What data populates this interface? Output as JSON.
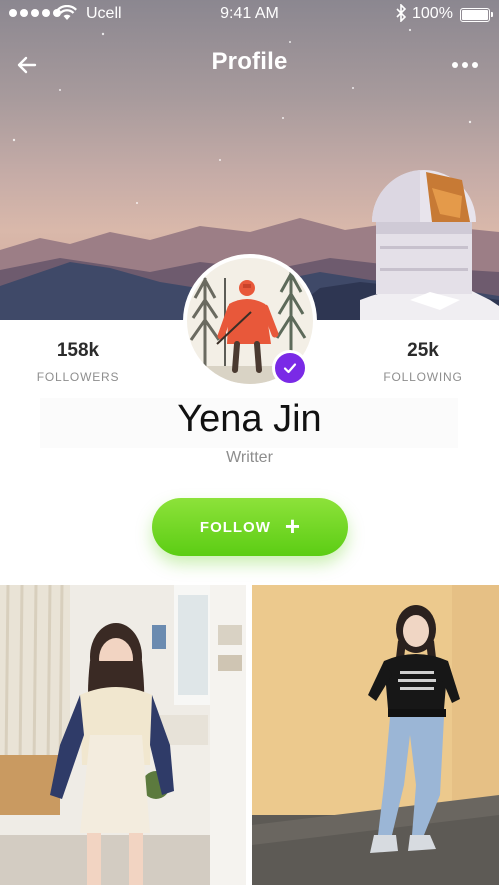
{
  "status_bar": {
    "carrier": "Ucell",
    "time": "9:41 AM",
    "battery": "100%",
    "signal_icon": "signal-dots-icon",
    "wifi_icon": "wifi-icon",
    "bluetooth_icon": "bluetooth-icon",
    "battery_icon": "battery-icon"
  },
  "nav": {
    "title": "Profile",
    "back_icon": "arrow-left-icon",
    "more_icon": "more-dots-icon"
  },
  "profile": {
    "name": "Yena Jin",
    "role": "Writter",
    "verified_icon": "checkmark-icon"
  },
  "stats": {
    "followers": {
      "value": "158k",
      "label": "FOLLOWERS"
    },
    "following": {
      "value": "25k",
      "label": "FOLLOWING"
    }
  },
  "follow_button": {
    "label": "FOLLOW",
    "icon": "plus-icon"
  },
  "colors": {
    "accent_green": "#6fd624",
    "verified_purple": "#7a2ae6",
    "text_dark": "#111111",
    "text_muted": "#8e8e8e"
  }
}
